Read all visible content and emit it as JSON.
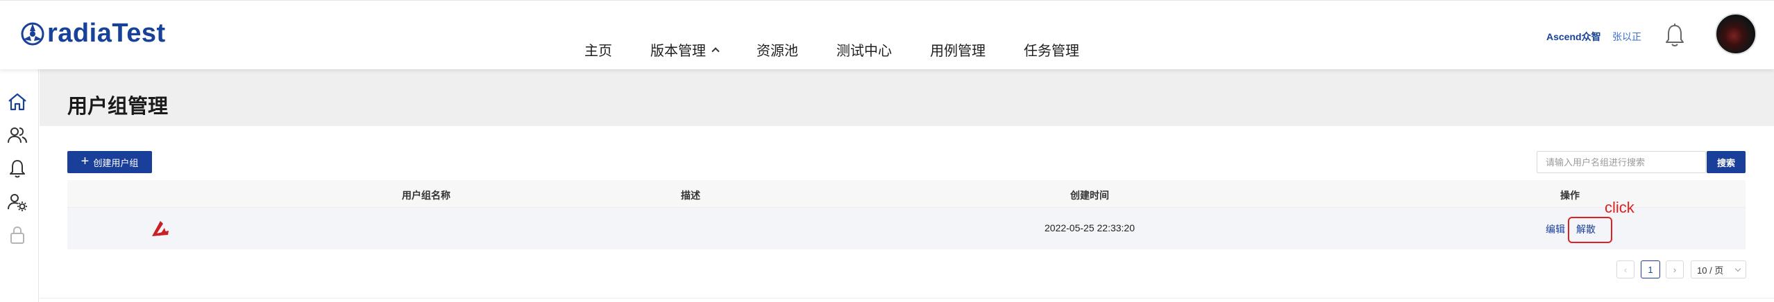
{
  "app": {
    "logo_text": "radiaTest",
    "brand_color": "#18419a"
  },
  "nav": {
    "items": [
      {
        "label": "主页"
      },
      {
        "label": "版本管理",
        "has_dropdown": true
      },
      {
        "label": "资源池"
      },
      {
        "label": "测试中心"
      },
      {
        "label": "用例管理"
      },
      {
        "label": "任务管理"
      }
    ]
  },
  "header_right": {
    "org": "Ascend众智",
    "user": "张以正",
    "icons": [
      "bell-icon",
      "avatar"
    ]
  },
  "sidebar": {
    "icons": [
      "home-icon",
      "users-icon",
      "bell-icon",
      "user-settings-icon",
      "lock-icon"
    ]
  },
  "page": {
    "title": "用户组管理"
  },
  "toolbar": {
    "create_label": "创建用户组",
    "search_placeholder": "请输入用户名组进行搜索",
    "search_label": "搜索"
  },
  "table": {
    "columns": [
      "用户组名称",
      "描述",
      "创建时间",
      "操作"
    ],
    "rows": [
      {
        "icon": "group-logo-icon",
        "name": "",
        "description": "",
        "created": "2022-05-25 22:33:20",
        "actions": [
          "编辑",
          "解散"
        ]
      }
    ]
  },
  "annotation": {
    "label": "click",
    "color": "#e02020"
  },
  "pagination": {
    "current_page": "1",
    "page_size": "10 / 页"
  }
}
